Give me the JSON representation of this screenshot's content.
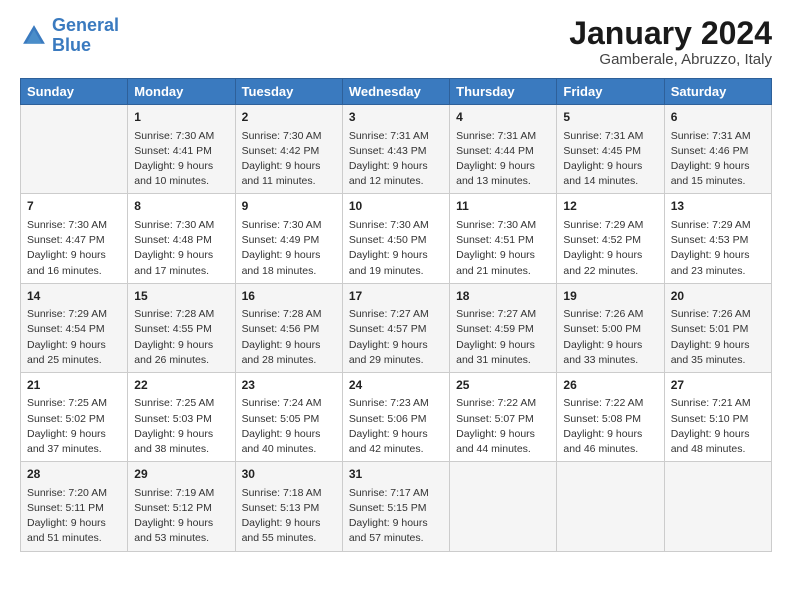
{
  "logo": {
    "line1": "General",
    "line2": "Blue"
  },
  "title": "January 2024",
  "location": "Gamberale, Abruzzo, Italy",
  "days_header": [
    "Sunday",
    "Monday",
    "Tuesday",
    "Wednesday",
    "Thursday",
    "Friday",
    "Saturday"
  ],
  "weeks": [
    [
      {
        "day": "",
        "content": ""
      },
      {
        "day": "1",
        "content": "Sunrise: 7:30 AM\nSunset: 4:41 PM\nDaylight: 9 hours\nand 10 minutes."
      },
      {
        "day": "2",
        "content": "Sunrise: 7:30 AM\nSunset: 4:42 PM\nDaylight: 9 hours\nand 11 minutes."
      },
      {
        "day": "3",
        "content": "Sunrise: 7:31 AM\nSunset: 4:43 PM\nDaylight: 9 hours\nand 12 minutes."
      },
      {
        "day": "4",
        "content": "Sunrise: 7:31 AM\nSunset: 4:44 PM\nDaylight: 9 hours\nand 13 minutes."
      },
      {
        "day": "5",
        "content": "Sunrise: 7:31 AM\nSunset: 4:45 PM\nDaylight: 9 hours\nand 14 minutes."
      },
      {
        "day": "6",
        "content": "Sunrise: 7:31 AM\nSunset: 4:46 PM\nDaylight: 9 hours\nand 15 minutes."
      }
    ],
    [
      {
        "day": "7",
        "content": "Sunrise: 7:30 AM\nSunset: 4:47 PM\nDaylight: 9 hours\nand 16 minutes."
      },
      {
        "day": "8",
        "content": "Sunrise: 7:30 AM\nSunset: 4:48 PM\nDaylight: 9 hours\nand 17 minutes."
      },
      {
        "day": "9",
        "content": "Sunrise: 7:30 AM\nSunset: 4:49 PM\nDaylight: 9 hours\nand 18 minutes."
      },
      {
        "day": "10",
        "content": "Sunrise: 7:30 AM\nSunset: 4:50 PM\nDaylight: 9 hours\nand 19 minutes."
      },
      {
        "day": "11",
        "content": "Sunrise: 7:30 AM\nSunset: 4:51 PM\nDaylight: 9 hours\nand 21 minutes."
      },
      {
        "day": "12",
        "content": "Sunrise: 7:29 AM\nSunset: 4:52 PM\nDaylight: 9 hours\nand 22 minutes."
      },
      {
        "day": "13",
        "content": "Sunrise: 7:29 AM\nSunset: 4:53 PM\nDaylight: 9 hours\nand 23 minutes."
      }
    ],
    [
      {
        "day": "14",
        "content": "Sunrise: 7:29 AM\nSunset: 4:54 PM\nDaylight: 9 hours\nand 25 minutes."
      },
      {
        "day": "15",
        "content": "Sunrise: 7:28 AM\nSunset: 4:55 PM\nDaylight: 9 hours\nand 26 minutes."
      },
      {
        "day": "16",
        "content": "Sunrise: 7:28 AM\nSunset: 4:56 PM\nDaylight: 9 hours\nand 28 minutes."
      },
      {
        "day": "17",
        "content": "Sunrise: 7:27 AM\nSunset: 4:57 PM\nDaylight: 9 hours\nand 29 minutes."
      },
      {
        "day": "18",
        "content": "Sunrise: 7:27 AM\nSunset: 4:59 PM\nDaylight: 9 hours\nand 31 minutes."
      },
      {
        "day": "19",
        "content": "Sunrise: 7:26 AM\nSunset: 5:00 PM\nDaylight: 9 hours\nand 33 minutes."
      },
      {
        "day": "20",
        "content": "Sunrise: 7:26 AM\nSunset: 5:01 PM\nDaylight: 9 hours\nand 35 minutes."
      }
    ],
    [
      {
        "day": "21",
        "content": "Sunrise: 7:25 AM\nSunset: 5:02 PM\nDaylight: 9 hours\nand 37 minutes."
      },
      {
        "day": "22",
        "content": "Sunrise: 7:25 AM\nSunset: 5:03 PM\nDaylight: 9 hours\nand 38 minutes."
      },
      {
        "day": "23",
        "content": "Sunrise: 7:24 AM\nSunset: 5:05 PM\nDaylight: 9 hours\nand 40 minutes."
      },
      {
        "day": "24",
        "content": "Sunrise: 7:23 AM\nSunset: 5:06 PM\nDaylight: 9 hours\nand 42 minutes."
      },
      {
        "day": "25",
        "content": "Sunrise: 7:22 AM\nSunset: 5:07 PM\nDaylight: 9 hours\nand 44 minutes."
      },
      {
        "day": "26",
        "content": "Sunrise: 7:22 AM\nSunset: 5:08 PM\nDaylight: 9 hours\nand 46 minutes."
      },
      {
        "day": "27",
        "content": "Sunrise: 7:21 AM\nSunset: 5:10 PM\nDaylight: 9 hours\nand 48 minutes."
      }
    ],
    [
      {
        "day": "28",
        "content": "Sunrise: 7:20 AM\nSunset: 5:11 PM\nDaylight: 9 hours\nand 51 minutes."
      },
      {
        "day": "29",
        "content": "Sunrise: 7:19 AM\nSunset: 5:12 PM\nDaylight: 9 hours\nand 53 minutes."
      },
      {
        "day": "30",
        "content": "Sunrise: 7:18 AM\nSunset: 5:13 PM\nDaylight: 9 hours\nand 55 minutes."
      },
      {
        "day": "31",
        "content": "Sunrise: 7:17 AM\nSunset: 5:15 PM\nDaylight: 9 hours\nand 57 minutes."
      },
      {
        "day": "",
        "content": ""
      },
      {
        "day": "",
        "content": ""
      },
      {
        "day": "",
        "content": ""
      }
    ]
  ]
}
